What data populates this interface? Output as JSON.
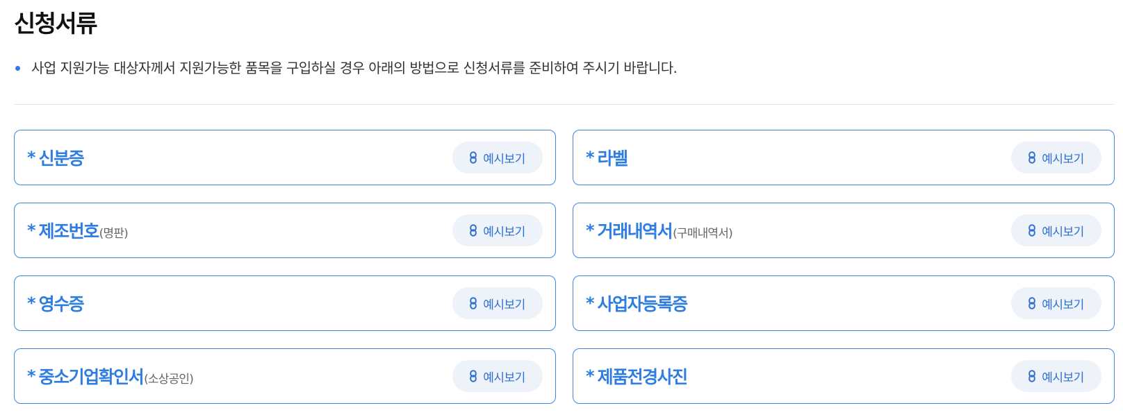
{
  "page": {
    "title": "신청서류",
    "description": "사업 지원가능 대상자께서 지원가능한 품목을 구입하실 경우 아래의 방법으로 신청서류를 준비하여 주시기 바랍니다."
  },
  "button_label": "예시보기",
  "accent_color": "#2f7de1",
  "icons": {
    "button_icon": "link-icon",
    "bullet": "dot-bullet"
  },
  "documents": [
    {
      "star": "*",
      "label": "신분증",
      "sub": ""
    },
    {
      "star": "*",
      "label": "라벨",
      "sub": ""
    },
    {
      "star": "*",
      "label": "제조번호",
      "sub": "(명판)"
    },
    {
      "star": "*",
      "label": "거래내역서",
      "sub": "(구매내역서)"
    },
    {
      "star": "*",
      "label": "영수증",
      "sub": ""
    },
    {
      "star": "*",
      "label": "사업자등록증",
      "sub": ""
    },
    {
      "star": "*",
      "label": "중소기업확인서",
      "sub": "(소상공인)"
    },
    {
      "star": "*",
      "label": "제품전경사진",
      "sub": ""
    }
  ]
}
